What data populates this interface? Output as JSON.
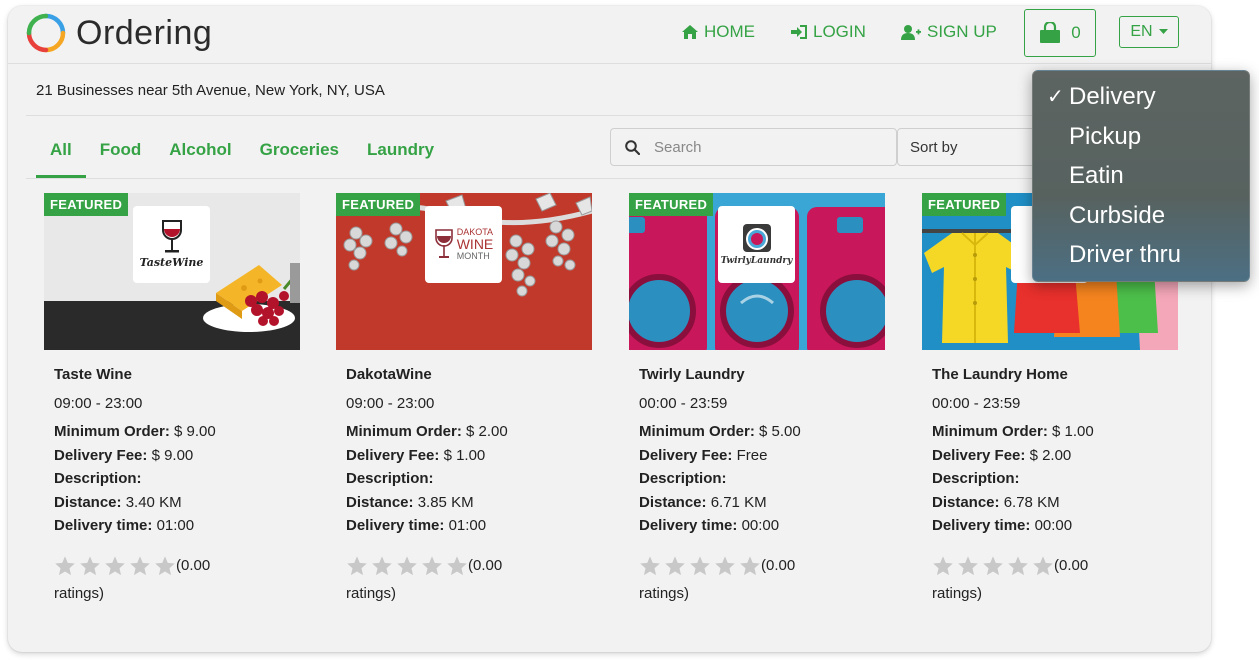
{
  "app": {
    "name": "Ordering",
    "colors": {
      "brand": "#35a345",
      "background": "#f2f2f2",
      "dropdown": "#5d6462"
    }
  },
  "nav": {
    "home": "HOME",
    "login": "LOGIN",
    "signup": "SIGN UP",
    "cart_count": "0",
    "language": "EN"
  },
  "location": {
    "text": "21 Businesses near 5th Avenue, New York, NY, USA"
  },
  "tabs": [
    {
      "label": "All",
      "active": true
    },
    {
      "label": "Food"
    },
    {
      "label": "Alcohol"
    },
    {
      "label": "Groceries"
    },
    {
      "label": "Laundry"
    }
  ],
  "search": {
    "placeholder": "Search",
    "value": ""
  },
  "sort": {
    "label": "Sort by"
  },
  "featured_label": "FEATURED",
  "labels": {
    "min_order": "Minimum Order:",
    "delivery_fee": "Delivery Fee:",
    "description": "Description:",
    "distance": "Distance:",
    "delivery_time": "Delivery time:"
  },
  "businesses": [
    {
      "name": "Taste Wine",
      "logo_text": "TasteWine",
      "hours": "09:00 - 23:00",
      "min_order": "$ 9.00",
      "delivery_fee": "$ 9.00",
      "description": "",
      "distance": "3.40 KM",
      "delivery_time": "01:00",
      "rating_a": "(0.00",
      "rating_b": "ratings)",
      "stars": 0
    },
    {
      "name": "DakotaWine",
      "logo_text_1": "DAKOTA",
      "logo_text_2": "WINE",
      "logo_text_3": "MONTH",
      "hours": "09:00 - 23:00",
      "min_order": "$ 2.00",
      "delivery_fee": "$ 1.00",
      "description": "",
      "distance": "3.85 KM",
      "delivery_time": "01:00",
      "rating_a": "(0.00",
      "rating_b": "ratings)",
      "stars": 0
    },
    {
      "name": "Twirly Laundry",
      "logo_text": "TwirlyLaundry",
      "hours": "00:00 - 23:59",
      "min_order": "$ 5.00",
      "delivery_fee": "Free",
      "description": "",
      "distance": "6.71 KM",
      "delivery_time": "00:00",
      "rating_a": "(0.00",
      "rating_b": "ratings)",
      "stars": 0
    },
    {
      "name": "The Laundry Home",
      "hours": "00:00 - 23:59",
      "min_order": "$ 1.00",
      "delivery_fee": "$ 2.00",
      "description": "",
      "distance": "6.78 KM",
      "delivery_time": "00:00",
      "rating_a": "(0.00",
      "rating_b": "ratings)",
      "stars": 0
    }
  ],
  "order_type_dropdown": {
    "selected": "Delivery",
    "check": "✓",
    "options": [
      "Delivery",
      "Pickup",
      "Eatin",
      "Curbside",
      "Driver thru"
    ]
  }
}
